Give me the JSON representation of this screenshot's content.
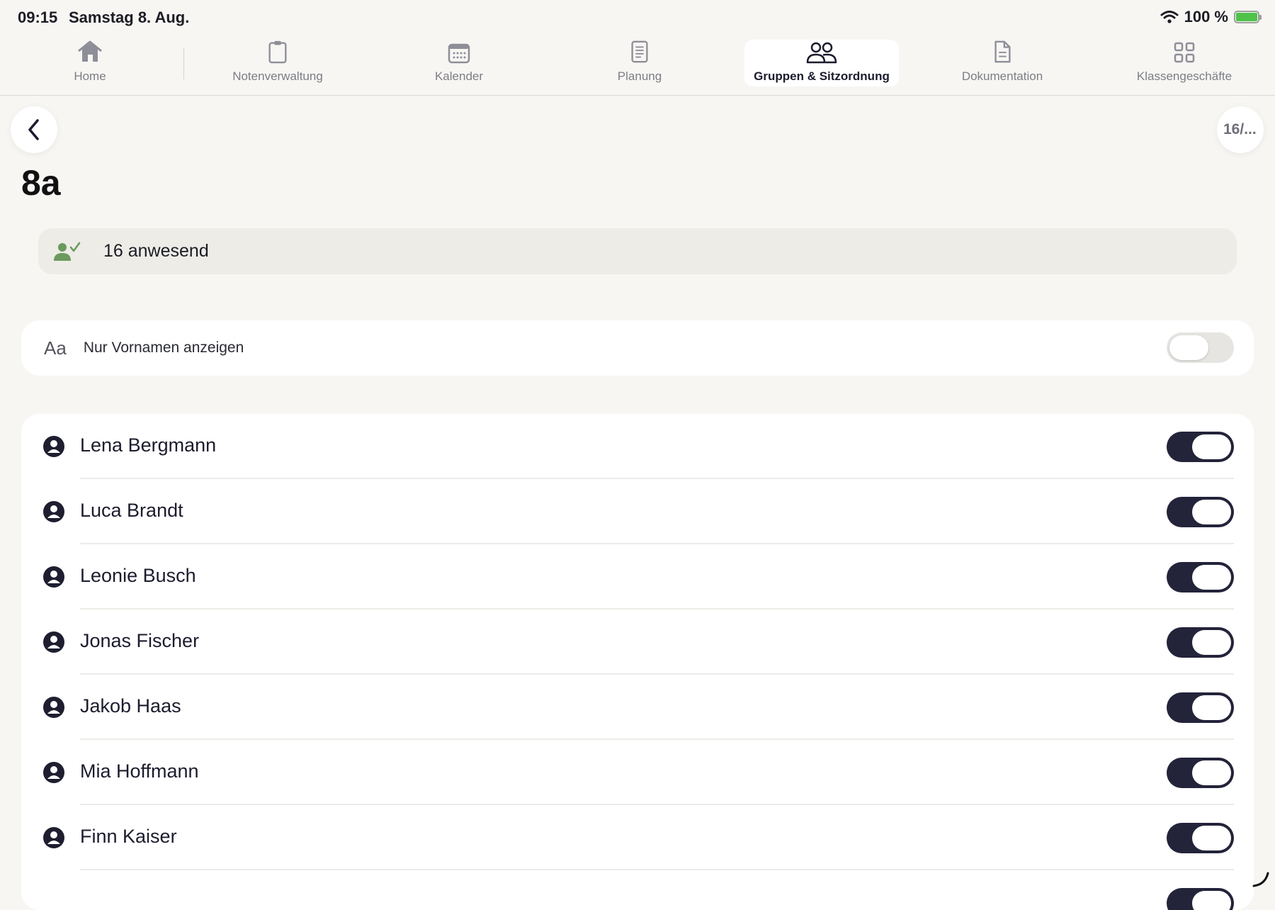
{
  "status_bar": {
    "time": "09:15",
    "date": "Samstag 8. Aug.",
    "battery": "100 %"
  },
  "tabs": [
    {
      "label": "Home",
      "icon": "house-icon",
      "active": false
    },
    {
      "label": "Notenverwaltung",
      "icon": "clipboard-icon",
      "active": false
    },
    {
      "label": "Kalender",
      "icon": "calendar-icon",
      "active": false
    },
    {
      "label": "Planung",
      "icon": "document-lines-icon",
      "active": false
    },
    {
      "label": "Gruppen & Sitzordnung",
      "icon": "people-icon",
      "active": true
    },
    {
      "label": "Dokumentation",
      "icon": "document-icon",
      "active": false
    },
    {
      "label": "Klassengeschäfte",
      "icon": "grid-icon",
      "active": false
    }
  ],
  "header": {
    "back_icon": "chevron-left-icon",
    "count_badge": "16/...",
    "title": "8a"
  },
  "presence": {
    "icon": "person-check-icon",
    "label": "16 anwesend"
  },
  "settings": {
    "aa_label": "Aa",
    "first_names_label": "Nur Vornamen anzeigen",
    "first_names_on": false
  },
  "students": [
    {
      "name": "Lena Bergmann",
      "present": true
    },
    {
      "name": "Luca Brandt",
      "present": true
    },
    {
      "name": "Leonie Busch",
      "present": true
    },
    {
      "name": "Jonas Fischer",
      "present": true
    },
    {
      "name": "Jakob Haas",
      "present": true
    },
    {
      "name": "Mia Hoffmann",
      "present": true
    },
    {
      "name": "Finn Kaiser",
      "present": true
    }
  ],
  "colors": {
    "accent": "#23233a",
    "background": "#f7f6f3",
    "presence_icon": "#6a9a5e",
    "battery": "#4fc24a"
  }
}
